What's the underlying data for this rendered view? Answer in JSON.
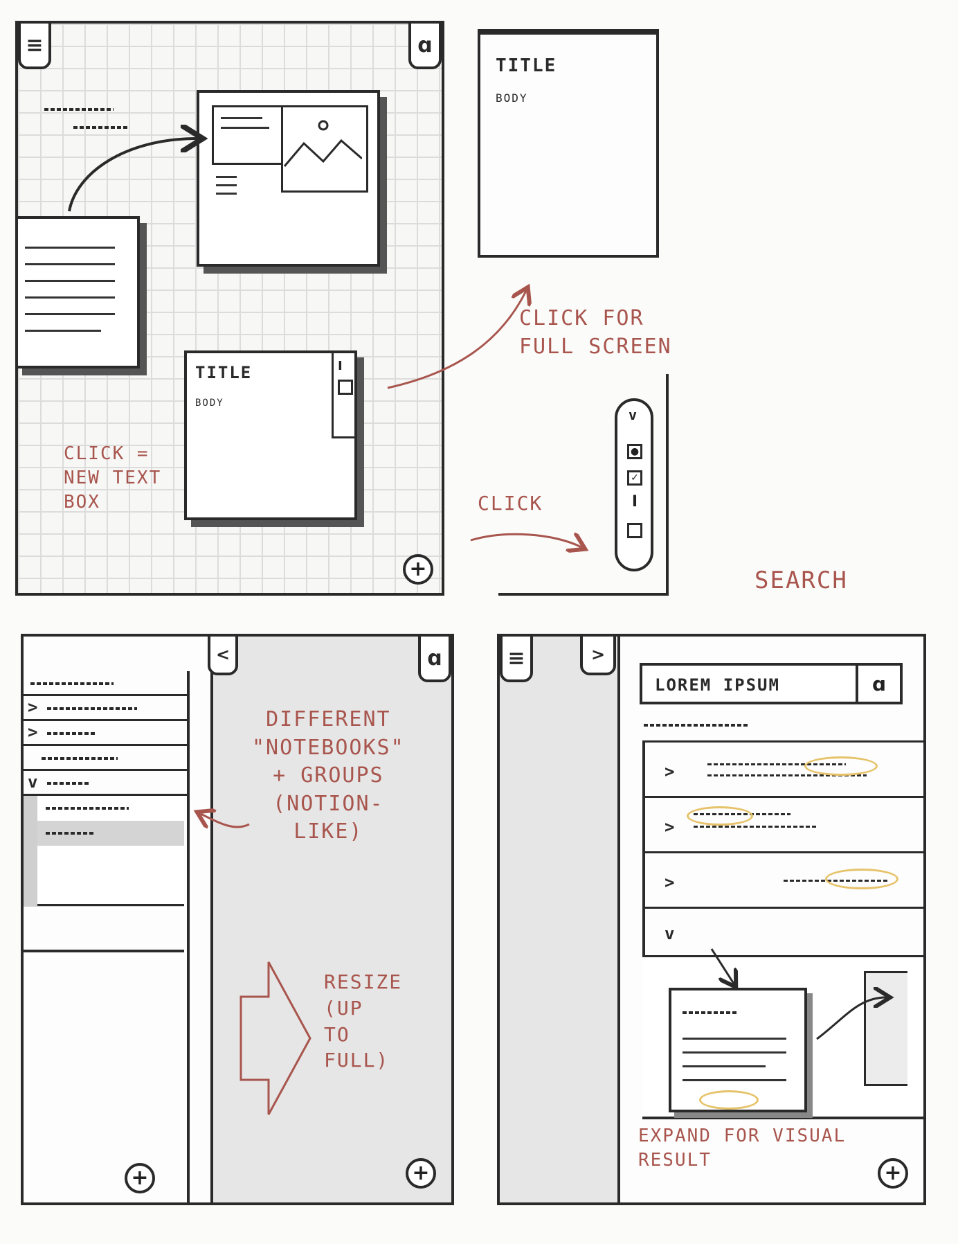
{
  "panel1": {
    "menu_icon": "menu-icon",
    "search_icon": "search-icon",
    "scribble_note": "",
    "text_card": {
      "title": "TITLE",
      "body": "BODY"
    },
    "note_click_new": "CLICK =\nNEW TEXT\nBOX",
    "add_button": "+"
  },
  "fullscreen": {
    "title": "TITLE",
    "body": "BODY"
  },
  "notes": {
    "click_full_screen": "CLICK FOR\nFULL SCREEN",
    "click": "CLICK",
    "search": "SEARCH",
    "notebooks": "DIFFERENT\n\"NOTEBOOKS\"\n+ GROUPS\n(NOTION-\nLIKE)",
    "resize": "RESIZE\n(UP\nTO\nFULL)",
    "expand": "EXPAND FOR VISUAL\nRESULT"
  },
  "toolbar": {
    "collapse": "v",
    "tools": [
      "circle-tool-icon",
      "image-tool-icon",
      "text-tool-icon",
      "page-tool-icon"
    ]
  },
  "panel3": {
    "collapse_label": "<",
    "add_button": "+",
    "add_button_sidebar": "+"
  },
  "panel4": {
    "expand_label": ">",
    "search_value": "LOREM IPSUM",
    "add_button": "+",
    "chevrons": [
      ">",
      ">",
      ">",
      "v"
    ]
  }
}
